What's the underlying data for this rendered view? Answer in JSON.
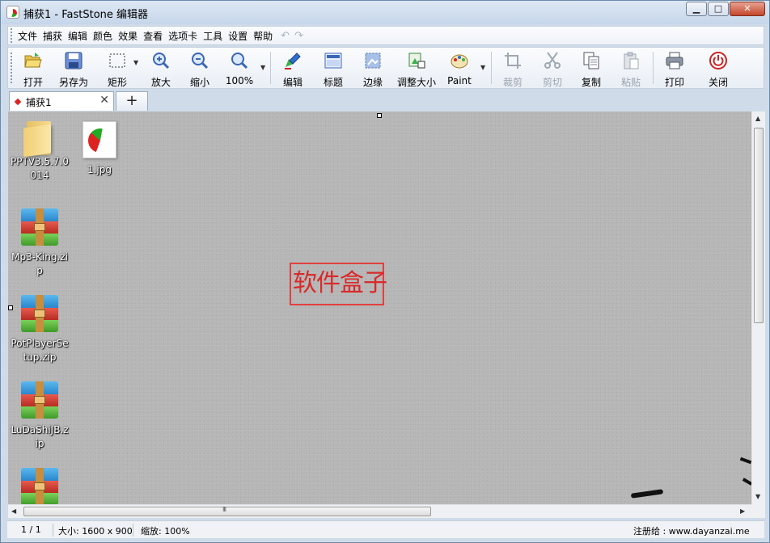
{
  "window": {
    "title": "捕获1 - FastStone 编辑器",
    "controls": {
      "minimize": "▁",
      "maximize": "□",
      "close": "✕"
    }
  },
  "menu": {
    "items": [
      "文件",
      "捕获",
      "编辑",
      "颜色",
      "效果",
      "查看",
      "选项卡",
      "工具",
      "设置",
      "帮助"
    ],
    "undo": "↶",
    "redo": "↷"
  },
  "toolbar": {
    "open": "打开",
    "save_as": "另存为",
    "rect": "矩形",
    "zoom_in": "放大",
    "zoom_out": "缩小",
    "zoom_100": "100%",
    "edit": "编辑",
    "caption": "标题",
    "edge": "边缘",
    "resize": "调整大小",
    "paint": "Paint",
    "crop": "裁剪",
    "cut": "剪切",
    "copy": "复制",
    "paste": "粘贴",
    "print": "打印",
    "close": "关闭"
  },
  "tabs": {
    "active_label": "捕获1",
    "close_glyph": "✕",
    "new_tab_glyph": "+"
  },
  "desktop": {
    "icons": [
      {
        "label": "PPTV3.5.7.0014",
        "type": "folder"
      },
      {
        "label": "1.jpg",
        "type": "image"
      },
      {
        "label": "Mp3-King.zip",
        "type": "zip"
      },
      {
        "label": "PotPlayerSetup.zip",
        "type": "zip"
      },
      {
        "label": "LuDaShiJB.zip",
        "type": "zip"
      }
    ],
    "annotation_text": "软件盒子"
  },
  "status": {
    "page": "1 / 1",
    "size": "大小: 1600 x 900",
    "zoom": "缩放: 100%",
    "registered": "注册给 : www.dayanzai.me"
  },
  "colors": {
    "annotation": "#d92a2a",
    "canvas_bg": "#b6b6b6",
    "frame": "#cfdbe9"
  }
}
